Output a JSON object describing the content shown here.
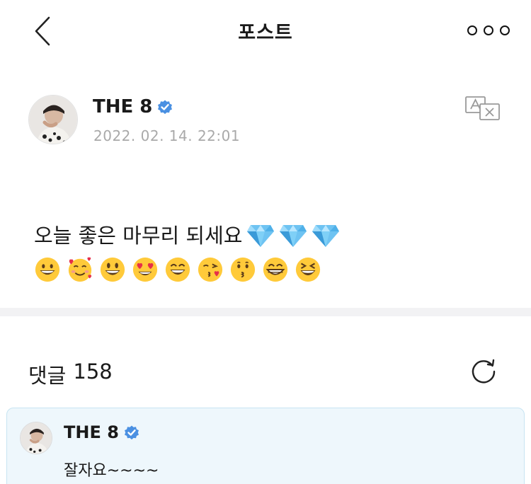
{
  "header": {
    "title": "포스트"
  },
  "post": {
    "author": "THE 8",
    "timestamp": "2022. 02. 14. 22:01",
    "text": "오늘 좋은 마무리 되세요",
    "gems": [
      "gem-stone-emoji",
      "gem-stone-emoji",
      "gem-stone-emoji"
    ],
    "emojis": [
      "grinning-face",
      "smiling-face-with-hearts",
      "grinning-face-big-eyes",
      "heart-eyes",
      "grinning-smiling-eyes",
      "face-blowing-kiss",
      "kissing-face",
      "beaming-face",
      "laughing-squinting-face"
    ]
  },
  "comments": {
    "label": "댓글",
    "count": "158",
    "items": [
      {
        "author": "THE 8",
        "text": "잘자요~~~~"
      }
    ]
  },
  "colors": {
    "verified": "#4a90e2",
    "timestamp": "#a9a9a9",
    "comment_bg": "#eef7fc",
    "comment_border": "#c7e4f2",
    "divider": "#f2f2f4"
  }
}
